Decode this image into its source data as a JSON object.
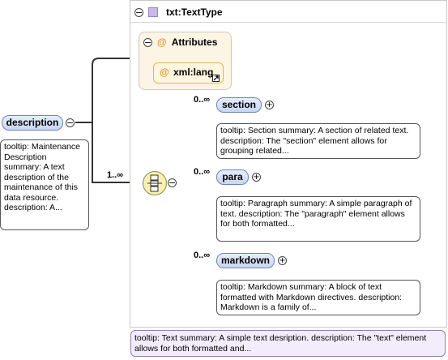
{
  "type_box": {
    "title": "txt:TextType"
  },
  "attributes": {
    "title": "Attributes",
    "item": "xml:lang",
    "at_symbol": "@"
  },
  "root": {
    "name": "description",
    "tooltip": "tooltip: Maintenance Description summary: A text description of the maintenance of this data resource. description: A..."
  },
  "sequence": {
    "occurrence": "1..∞"
  },
  "children": [
    {
      "name": "section",
      "occurrence": "0..∞",
      "tooltip": "tooltip: Section summary: A section of related text. description: The \"section\" element allows for grouping related..."
    },
    {
      "name": "para",
      "occurrence": "0..∞",
      "tooltip": "tooltip: Paragraph summary: A simple paragraph of text. description: The \"paragraph\" element allows for both formatted..."
    },
    {
      "name": "markdown",
      "occurrence": "0..∞",
      "tooltip": "tooltip: Markdown summary: A block of text formatted with Markdown directives. description: Markdown is a family of..."
    }
  ],
  "type_tooltip": "tooltip: Text summary: A simple text desription. description: The \"text\" element allows for both formatted and...",
  "colors": {
    "element_fill": "#c7d6f0",
    "attribute_accent": "#e0972a",
    "type_square": "#c9b8e8"
  }
}
